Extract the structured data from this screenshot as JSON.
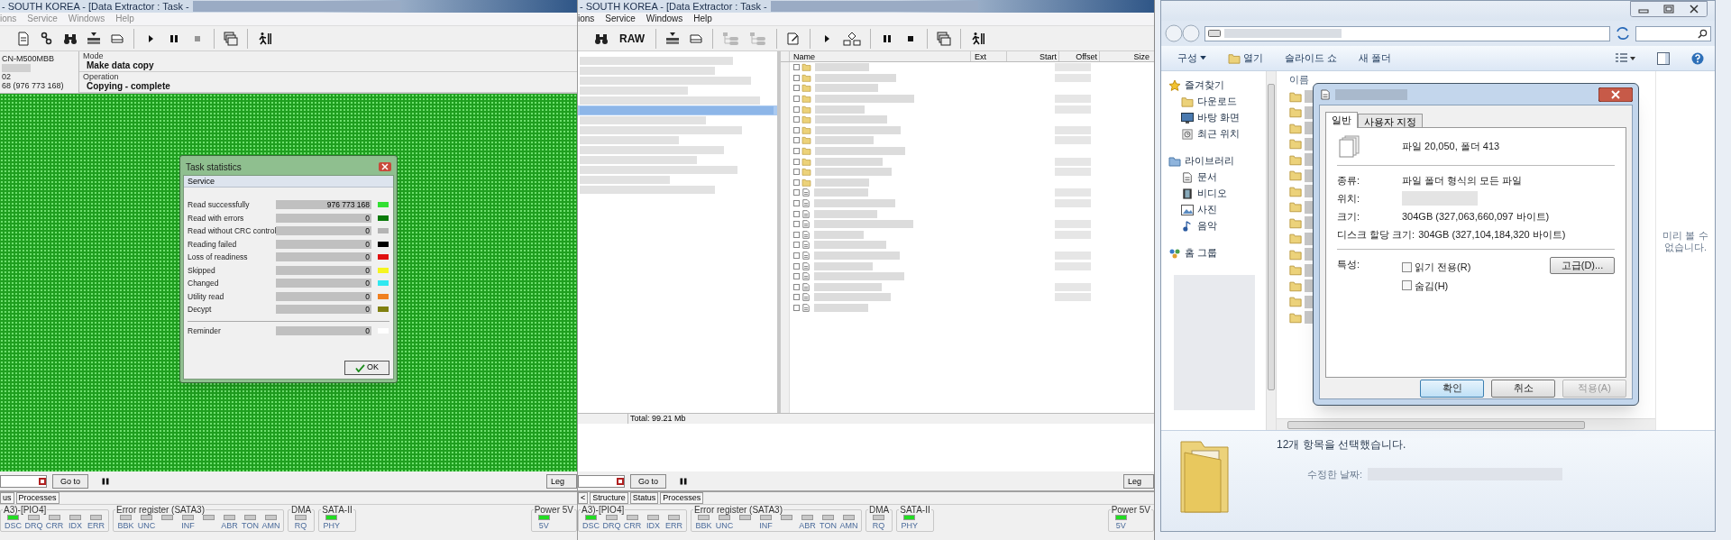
{
  "left_app": {
    "title": "- SOUTH KOREA - [Data Extractor : Task -",
    "menu_dimmed": true,
    "menu": [
      "ions",
      "Service",
      "Windows",
      "Help"
    ],
    "toolbar": [
      {
        "kind": "percent",
        "disabled": false
      },
      {
        "kind": "probe",
        "disabled": false
      },
      {
        "kind": "binoculars",
        "disabled": false
      },
      {
        "kind": "tray",
        "disabled": false
      },
      {
        "kind": "drive",
        "disabled": false
      },
      {
        "kind": "separator"
      },
      {
        "kind": "play",
        "disabled": false
      },
      {
        "kind": "pause",
        "disabled": false
      },
      {
        "kind": "stop",
        "disabled": true
      },
      {
        "kind": "separator"
      },
      {
        "kind": "windows",
        "disabled": false
      },
      {
        "kind": "separator"
      },
      {
        "kind": "runner",
        "disabled": false
      }
    ],
    "device_lines": [
      {
        "kind": "text",
        "text": "CN-M500MBB"
      },
      {
        "kind": "redacted"
      },
      {
        "kind": "text",
        "text": "02"
      },
      {
        "kind": "text",
        "text": "68 (976 773 168)"
      }
    ],
    "mode": {
      "label": "Mode",
      "value": "Make data copy"
    },
    "operation": {
      "label": "Operation",
      "value": "Copying - complete"
    },
    "task_statistics": {
      "title": "Task statistics",
      "section": "Service",
      "rows": [
        {
          "label": "Read successfully",
          "value": "976 773 168",
          "color": "#33e033"
        },
        {
          "label": "Read with errors",
          "value": "0",
          "color": "#0a7a0a"
        },
        {
          "label": "Read without CRC control",
          "value": "0",
          "color": "#b4b4b4"
        },
        {
          "label": "Reading failed",
          "value": "0",
          "color": "#000000"
        },
        {
          "label": "Loss of readiness",
          "value": "0",
          "color": "#e01010"
        },
        {
          "label": "Skipped",
          "value": "0",
          "color": "#f5f520"
        },
        {
          "label": "Changed",
          "value": "0",
          "color": "#30e8f0"
        },
        {
          "label": "Utility read",
          "value": "0",
          "color": "#f08020"
        },
        {
          "label": "Decypt",
          "value": "0",
          "color": "#808010"
        }
      ],
      "reminder": {
        "label": "Reminder",
        "value": "0",
        "color": "#ffffff"
      },
      "ok_button": "OK"
    },
    "goto_button": "Go to",
    "legend_button": "Leg",
    "tabs": [
      "us",
      "Processes"
    ],
    "status_groups": [
      {
        "title": "A3)-[PIO4]",
        "leds": [
          {
            "label": "DSC",
            "on": true
          },
          {
            "label": "DRQ",
            "on": false
          },
          {
            "label": "CRR",
            "on": false
          },
          {
            "label": "IDX",
            "on": false
          },
          {
            "label": "ERR",
            "on": false
          }
        ]
      },
      {
        "title": "Error register (SATA3)",
        "leds": [
          {
            "label": "BBK",
            "on": false
          },
          {
            "label": "UNC",
            "on": false
          },
          {
            "on": false
          },
          {
            "label": "INF",
            "on": false
          },
          {
            "on": false
          },
          {
            "label": "ABR",
            "on": false
          },
          {
            "label": "TON",
            "on": false
          },
          {
            "label": "AMN",
            "on": false
          }
        ]
      },
      {
        "title": "DMA",
        "leds": [
          {
            "label": "RQ",
            "on": false
          }
        ]
      },
      {
        "title": "SATA-II",
        "leds": [
          {
            "label": "PHY",
            "on": true
          }
        ]
      }
    ],
    "power_group": {
      "title": "Power 5V",
      "leds": [
        {
          "label": "5V",
          "on": true
        }
      ]
    }
  },
  "middle_app": {
    "title": "- SOUTH KOREA - [Data Extractor : Task -",
    "menu_dimmed": false,
    "menu": [
      "ions",
      "Service",
      "Windows",
      "Help"
    ],
    "toolbar": [
      {
        "kind": "binoculars",
        "disabled": false
      },
      {
        "kind": "text",
        "label": "RAW",
        "disabled": false
      },
      {
        "kind": "separator"
      },
      {
        "kind": "tray",
        "disabled": false
      },
      {
        "kind": "drive",
        "disabled": false
      },
      {
        "kind": "separator"
      },
      {
        "kind": "tree",
        "disabled": true
      },
      {
        "kind": "tree",
        "disabled": true
      },
      {
        "kind": "separator"
      },
      {
        "kind": "document",
        "disabled": false
      },
      {
        "kind": "separator"
      },
      {
        "kind": "play",
        "disabled": false
      },
      {
        "kind": "diagram",
        "disabled": false
      },
      {
        "kind": "separator"
      },
      {
        "kind": "pause",
        "disabled": false
      },
      {
        "kind": "stop",
        "disabled": false
      },
      {
        "kind": "separator"
      },
      {
        "kind": "windows",
        "disabled": false
      },
      {
        "kind": "separator"
      },
      {
        "kind": "runner",
        "disabled": false
      }
    ],
    "tree_rows": [
      {
        "selected": false
      },
      {
        "selected": false
      },
      {
        "selected": false
      },
      {
        "selected": false
      },
      {
        "selected": false
      },
      {
        "selected": true
      },
      {
        "selected": false
      },
      {
        "selected": false
      },
      {
        "selected": false
      },
      {
        "selected": false
      },
      {
        "selected": false
      },
      {
        "selected": false
      },
      {
        "selected": false
      },
      {
        "selected": false
      }
    ],
    "file_list": {
      "columns": [
        "Name",
        "Ext",
        "Start",
        "Offset",
        "Size"
      ],
      "rows": [
        {
          "kind": "folder",
          "checked": false
        },
        {
          "kind": "folder",
          "checked": false
        },
        {
          "kind": "folder",
          "checked": false
        },
        {
          "kind": "folder",
          "checked": false
        },
        {
          "kind": "folder",
          "checked": false
        },
        {
          "kind": "folder",
          "checked": false
        },
        {
          "kind": "folder",
          "checked": false
        },
        {
          "kind": "folder",
          "checked": false
        },
        {
          "kind": "folder",
          "checked": false
        },
        {
          "kind": "folder",
          "checked": false
        },
        {
          "kind": "folder",
          "checked": false
        },
        {
          "kind": "folder",
          "checked": false
        },
        {
          "kind": "file",
          "checked": false
        },
        {
          "kind": "file",
          "checked": false
        },
        {
          "kind": "file",
          "checked": false
        },
        {
          "kind": "file",
          "checked": false
        },
        {
          "kind": "file",
          "checked": false
        },
        {
          "kind": "file",
          "checked": false
        },
        {
          "kind": "file",
          "checked": false
        },
        {
          "kind": "file",
          "checked": false
        },
        {
          "kind": "file",
          "checked": false
        },
        {
          "kind": "file",
          "checked": false
        },
        {
          "kind": "file",
          "checked": false
        },
        {
          "kind": "file",
          "checked": false
        }
      ]
    },
    "total": "Total: 99.21 Mb",
    "goto_button": "Go to",
    "legend_button": "Leg",
    "tabs": [
      "<",
      "Structure",
      "Status",
      "Processes"
    ],
    "status_groups": [
      {
        "title": "A3)-[PIO4]",
        "leds": [
          {
            "label": "DSC",
            "on": true
          },
          {
            "label": "DRQ",
            "on": false
          },
          {
            "label": "CRR",
            "on": false
          },
          {
            "label": "IDX",
            "on": false
          },
          {
            "label": "ERR",
            "on": false
          }
        ]
      },
      {
        "title": "Error register (SATA3)",
        "leds": [
          {
            "label": "BBK",
            "on": false
          },
          {
            "label": "UNC",
            "on": false
          },
          {
            "on": false
          },
          {
            "label": "INF",
            "on": false
          },
          {
            "on": false
          },
          {
            "label": "ABR",
            "on": false
          },
          {
            "label": "TON",
            "on": false
          },
          {
            "label": "AMN",
            "on": false
          }
        ]
      },
      {
        "title": "DMA",
        "leds": [
          {
            "label": "RQ",
            "on": false
          }
        ]
      },
      {
        "title": "SATA-II",
        "leds": [
          {
            "label": "PHY",
            "on": true
          }
        ]
      }
    ],
    "power_group": {
      "title": "Power 5V",
      "leds": [
        {
          "label": "5V",
          "on": true
        }
      ]
    }
  },
  "explorer": {
    "toolbar": [
      "구성",
      "열기",
      "슬라이드 쇼",
      "새 폴더"
    ],
    "nav": [
      {
        "label": "즐겨찾기",
        "children": [
          {
            "label": "다운로드"
          },
          {
            "label": "바탕 화면"
          },
          {
            "label": "최근 위치"
          }
        ]
      },
      {
        "label": "라이브러리",
        "children": [
          {
            "label": "문서"
          },
          {
            "label": "비디오"
          },
          {
            "label": "사진"
          },
          {
            "label": "음악"
          }
        ]
      },
      {
        "label": "홈 그룹"
      }
    ],
    "columns": [
      "이름"
    ],
    "preview_message": "미리 볼 수 없습니다.",
    "details": {
      "selection": "12개 항목을 선택했습니다.",
      "modified_label": "수정한 날짜:"
    },
    "properties_dialog": {
      "tabs": [
        {
          "label": "일반",
          "selected": true
        },
        {
          "label": "사용자 지정",
          "selected": false
        }
      ],
      "summary": "파일 20,050, 폴더 413",
      "fields": [
        {
          "kind": "text",
          "label": "종류:",
          "value": "파일 폴더 형식의 모든 파일"
        },
        {
          "kind": "redacted",
          "label": "위치:"
        },
        {
          "kind": "text",
          "label": "크기:",
          "value": "304GB (327,063,660,097 바이트)"
        },
        {
          "kind": "text",
          "label": "디스크 할당 크기:",
          "value": "304GB (327,104,184,320 바이트)"
        }
      ],
      "attributes_label": "특성:",
      "attributes": [
        {
          "label": "읽기 전용(R)",
          "checked": false
        },
        {
          "label": "숨김(H)",
          "checked": false
        }
      ],
      "advanced_button": "고급(D)...",
      "buttons": [
        {
          "label": "확인",
          "default": true,
          "disabled": false
        },
        {
          "label": "취소",
          "default": false,
          "disabled": false
        },
        {
          "label": "적용(A)",
          "default": false,
          "disabled": true
        }
      ]
    }
  }
}
